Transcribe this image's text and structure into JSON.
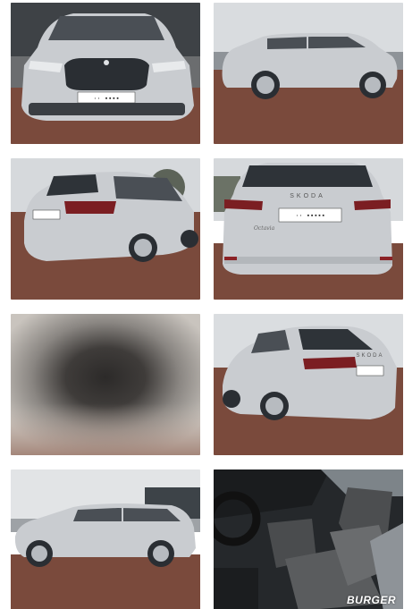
{
  "gallery": {
    "photos": [
      {
        "view": "front",
        "icon": "car-front-photo-icon"
      },
      {
        "view": "side-right",
        "icon": "car-side-photo-icon"
      },
      {
        "view": "rear-left-quarter",
        "icon": "car-rear-quarter-photo-icon"
      },
      {
        "view": "rear",
        "icon": "car-rear-photo-icon",
        "badge": "SKODA",
        "model_script": "Octavia"
      },
      {
        "view": "blurred",
        "icon": "blurred-photo-icon"
      },
      {
        "view": "rear-right-quarter",
        "icon": "car-rear-quarter-photo-icon",
        "badge": "SKODA"
      },
      {
        "view": "side-left",
        "icon": "car-side-photo-icon"
      },
      {
        "view": "interior-seats",
        "icon": "car-interior-photo-icon"
      }
    ],
    "watermark": "BURGER"
  },
  "colors": {
    "car_silver": "#c9ccd0",
    "pavement": "#7a4a3c",
    "sky": "#d9dcdf"
  }
}
